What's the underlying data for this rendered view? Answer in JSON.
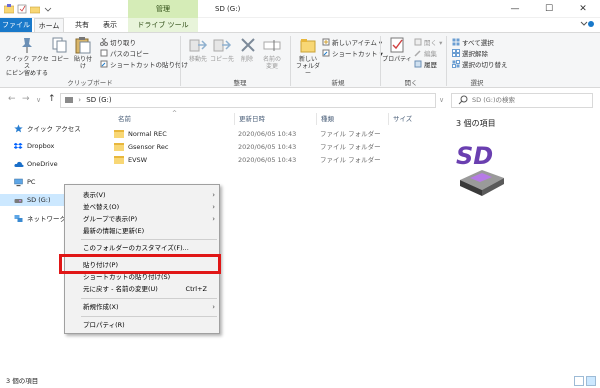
{
  "window": {
    "title": "SD (G:)",
    "context_tab_header": "管理",
    "minimize": "—",
    "maximize": "☐",
    "close": "✕"
  },
  "ribbon_tabs": {
    "file": "ファイル",
    "home": "ホーム",
    "share": "共有",
    "view": "表示",
    "drive_tools": "ドライブ ツール"
  },
  "ribbon": {
    "clipboard": {
      "pin": "クイック アクセス\nにピン留めする",
      "copy": "コピー",
      "paste": "貼り付け",
      "cut": "切り取り",
      "copy_path": "パスのコピー",
      "paste_shortcut": "ショートカットの貼り付け",
      "label": "クリップボード"
    },
    "organize": {
      "move_to": "移動先",
      "copy_to": "コピー先",
      "delete": "削除",
      "rename": "名前の\n変更",
      "label": "整理"
    },
    "new": {
      "new_folder": "新しい\nフォルダー",
      "new_item": "新しいアイテム ▾",
      "shortcut": "ショートカット ▾",
      "label": "新規"
    },
    "open": {
      "properties": "プロパティ",
      "open": "開く ▾",
      "edit": "編集",
      "history": "履歴",
      "label": "開く"
    },
    "select": {
      "select_all": "すべて選択",
      "select_none": "選択解除",
      "invert": "選択の切り替え",
      "label": "選択"
    }
  },
  "nav": {
    "back": "←",
    "forward": "→",
    "recent": "∨",
    "up": "↑",
    "address": "SD (G:)",
    "search_placeholder": "SD (G:)の検索"
  },
  "sidebar": {
    "items": [
      {
        "label": "クイック アクセス"
      },
      {
        "label": "Dropbox"
      },
      {
        "label": "OneDrive"
      },
      {
        "label": "PC"
      },
      {
        "label": "SD (G:)"
      },
      {
        "label": "ネットワーク"
      }
    ]
  },
  "columns": {
    "name": "名前",
    "date": "更新日時",
    "type": "種類",
    "size": "サイズ"
  },
  "files": [
    {
      "name": "Normal REC",
      "date": "2020/06/05 10:43",
      "type": "ファイル フォルダー"
    },
    {
      "name": "Gsensor Rec",
      "date": "2020/06/05 10:43",
      "type": "ファイル フォルダー"
    },
    {
      "name": "EVSW",
      "date": "2020/06/05 10:43",
      "type": "ファイル フォルダー"
    }
  ],
  "preview": {
    "count": "3 個の項目",
    "logo_text": "SD"
  },
  "status": {
    "count": "3 個の項目"
  },
  "context_menu": {
    "view": "表示(V)",
    "sort": "並べ替え(O)",
    "group": "グループで表示(P)",
    "refresh": "最新の情報に更新(E)",
    "customize": "このフォルダーのカスタマイズ(F)...",
    "paste": "貼り付け(P)",
    "paste_shortcut": "ショートカットの貼り付け(S)",
    "undo": "元に戻す - 名前の変更(U)",
    "undo_shortcut": "Ctrl+Z",
    "new": "新規作成(X)",
    "properties": "プロパティ(R)"
  },
  "colors": {
    "accent": "#1979ca",
    "highlight_box": "#e01616",
    "selected_nav": "#cce8ff",
    "context_tab": "#d5ecb7"
  }
}
